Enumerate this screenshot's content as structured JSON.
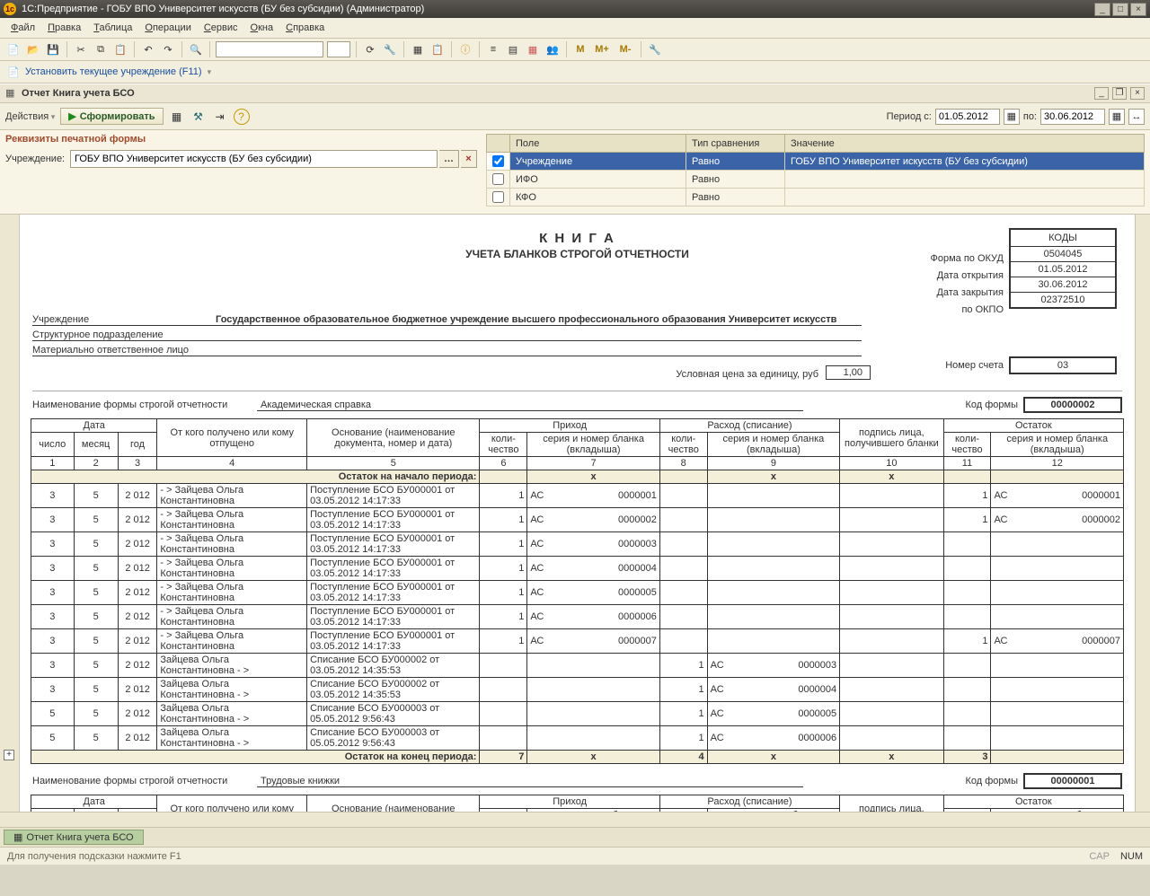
{
  "title": "1С:Предприятие - ГОБУ ВПО Университет искусств (БУ без субсидии) (Администратор)",
  "menus": [
    "Файл",
    "Правка",
    "Таблица",
    "Операции",
    "Сервис",
    "Окна",
    "Справка"
  ],
  "toolbar2_text": "Установить текущее учреждение (F11)",
  "report_window_title": "Отчет  Книга учета БСО",
  "actions": {
    "actions_label": "Действия",
    "form_label": "Сформировать"
  },
  "period": {
    "label_from": "Период с:",
    "from": "01.05.2012",
    "label_to": "по:",
    "to": "30.06.2012"
  },
  "params_header": "Реквизиты печатной формы",
  "org_field": {
    "label": "Учреждение:",
    "value": "ГОБУ ВПО Университет искусств (БУ без субсидии)"
  },
  "filter_headers": {
    "c1": "Поле",
    "c2": "Тип сравнения",
    "c3": "Значение"
  },
  "filters": [
    {
      "checked": true,
      "f": "Учреждение",
      "op": "Равно",
      "v": "ГОБУ ВПО Университет искусств (БУ без субсидии)",
      "sel": true
    },
    {
      "checked": false,
      "f": "ИФО",
      "op": "Равно",
      "v": ""
    },
    {
      "checked": false,
      "f": "КФО",
      "op": "Равно",
      "v": ""
    }
  ],
  "book": {
    "title": "К Н И Г А",
    "subtitle": "УЧЕТА БЛАНКОВ СТРОГОЙ ОТЧЕТНОСТИ",
    "codes_header": "КОДЫ",
    "code_labels": [
      "Форма по ОКУД",
      "Дата открытия",
      "Дата закрытия",
      "по ОКПО"
    ],
    "code_values": [
      "0504045",
      "01.05.2012",
      "30.06.2012",
      "02372510"
    ],
    "org_labels": [
      "Учреждение",
      "Структурное подразделение",
      "Материально ответственное лицо"
    ],
    "org_values": [
      "Государственное образовательное бюджетное учреждение высшего профессионального образования  Университет искусств",
      "",
      ""
    ],
    "unit_price_label": "Условная цена за единицу, руб",
    "unit_price": "1,00",
    "acct_label": "Номер счета",
    "acct_value": "03"
  },
  "form1": {
    "label": "Наименование формы строгой отчетности",
    "name": "Академическая справка",
    "code_label": "Код формы",
    "code_value": "00000002"
  },
  "form2": {
    "label": "Наименование формы строгой отчетности",
    "name": "Трудовые книжки",
    "code_label": "Код формы",
    "code_value": "00000001"
  },
  "th": {
    "date": "Дата",
    "from": "От кого получено или кому отпущено",
    "basis": "Основание (наименование документа, номер и дата)",
    "income": "Приход",
    "expense": "Расход (списание)",
    "balance": "Остаток",
    "day": "число",
    "month": "месяц",
    "year": "год",
    "qty": "коли-чество",
    "series": "серия и номер бланка (вкладыша)",
    "sign": "подпись лица, получившего бланки"
  },
  "colnums": [
    "1",
    "2",
    "3",
    "4",
    "5",
    "6",
    "7",
    "8",
    "9",
    "10",
    "11",
    "12"
  ],
  "opening_label": "Остаток на начало периода:",
  "closing_label": "Остаток на конец периода:",
  "x": "x",
  "closing_vals": {
    "c6": "7",
    "c8": "4",
    "c11": "3"
  },
  "rows": [
    {
      "d": "3",
      "m": "5",
      "y": "2 012",
      "from": "- > Зайцева Ольга Константиновна",
      "basis": "Поступление БСО БУ000001 от 03.05.2012 14:17:33",
      "q6": "1",
      "s7a": "АС",
      "s7b": "0000001",
      "q8": "",
      "s9a": "",
      "s9b": "",
      "q11": "1",
      "s12a": "АС",
      "s12b": "0000001"
    },
    {
      "d": "3",
      "m": "5",
      "y": "2 012",
      "from": "- > Зайцева Ольга Константиновна",
      "basis": "Поступление БСО БУ000001 от 03.05.2012 14:17:33",
      "q6": "1",
      "s7a": "АС",
      "s7b": "0000002",
      "q8": "",
      "s9a": "",
      "s9b": "",
      "q11": "1",
      "s12a": "АС",
      "s12b": "0000002"
    },
    {
      "d": "3",
      "m": "5",
      "y": "2 012",
      "from": "- > Зайцева Ольга Константиновна",
      "basis": "Поступление БСО БУ000001 от 03.05.2012 14:17:33",
      "q6": "1",
      "s7a": "АС",
      "s7b": "0000003",
      "q8": "",
      "s9a": "",
      "s9b": "",
      "q11": "",
      "s12a": "",
      "s12b": ""
    },
    {
      "d": "3",
      "m": "5",
      "y": "2 012",
      "from": "- > Зайцева Ольга Константиновна",
      "basis": "Поступление БСО БУ000001 от 03.05.2012 14:17:33",
      "q6": "1",
      "s7a": "АС",
      "s7b": "0000004",
      "q8": "",
      "s9a": "",
      "s9b": "",
      "q11": "",
      "s12a": "",
      "s12b": ""
    },
    {
      "d": "3",
      "m": "5",
      "y": "2 012",
      "from": "- > Зайцева Ольга Константиновна",
      "basis": "Поступление БСО БУ000001 от 03.05.2012 14:17:33",
      "q6": "1",
      "s7a": "АС",
      "s7b": "0000005",
      "q8": "",
      "s9a": "",
      "s9b": "",
      "q11": "",
      "s12a": "",
      "s12b": ""
    },
    {
      "d": "3",
      "m": "5",
      "y": "2 012",
      "from": "- > Зайцева Ольга Константиновна",
      "basis": "Поступление БСО БУ000001 от 03.05.2012 14:17:33",
      "q6": "1",
      "s7a": "АС",
      "s7b": "0000006",
      "q8": "",
      "s9a": "",
      "s9b": "",
      "q11": "",
      "s12a": "",
      "s12b": ""
    },
    {
      "d": "3",
      "m": "5",
      "y": "2 012",
      "from": "- > Зайцева Ольга Константиновна",
      "basis": "Поступление БСО БУ000001 от 03.05.2012 14:17:33",
      "q6": "1",
      "s7a": "АС",
      "s7b": "0000007",
      "q8": "",
      "s9a": "",
      "s9b": "",
      "q11": "1",
      "s12a": "АС",
      "s12b": "0000007"
    },
    {
      "d": "3",
      "m": "5",
      "y": "2 012",
      "from": "Зайцева Ольга Константиновна - >",
      "basis": "Списание БСО БУ000002 от 03.05.2012 14:35:53",
      "q6": "",
      "s7a": "",
      "s7b": "",
      "q8": "1",
      "s9a": "АС",
      "s9b": "0000003",
      "q11": "",
      "s12a": "",
      "s12b": ""
    },
    {
      "d": "3",
      "m": "5",
      "y": "2 012",
      "from": "Зайцева Ольга Константиновна - >",
      "basis": "Списание БСО БУ000002 от 03.05.2012 14:35:53",
      "q6": "",
      "s7a": "",
      "s7b": "",
      "q8": "1",
      "s9a": "АС",
      "s9b": "0000004",
      "q11": "",
      "s12a": "",
      "s12b": ""
    },
    {
      "d": "5",
      "m": "5",
      "y": "2 012",
      "from": "Зайцева Ольга Константиновна - >",
      "basis": "Списание БСО БУ000003 от 05.05.2012 9:56:43",
      "q6": "",
      "s7a": "",
      "s7b": "",
      "q8": "1",
      "s9a": "АС",
      "s9b": "0000005",
      "q11": "",
      "s12a": "",
      "s12b": ""
    },
    {
      "d": "5",
      "m": "5",
      "y": "2 012",
      "from": "Зайцева Ольга Константиновна - >",
      "basis": "Списание БСО БУ000003 от 05.05.2012 9:56:43",
      "q6": "",
      "s7a": "",
      "s7b": "",
      "q8": "1",
      "s9a": "АС",
      "s9b": "0000006",
      "q11": "",
      "s12a": "",
      "s12b": ""
    }
  ],
  "tab_label": "Отчет  Книга учета БСО",
  "status_hint": "Для получения подсказки нажмите F1",
  "status_cap": "CAP",
  "status_num": "NUM",
  "m_btns": [
    "M",
    "M+",
    "M-"
  ]
}
